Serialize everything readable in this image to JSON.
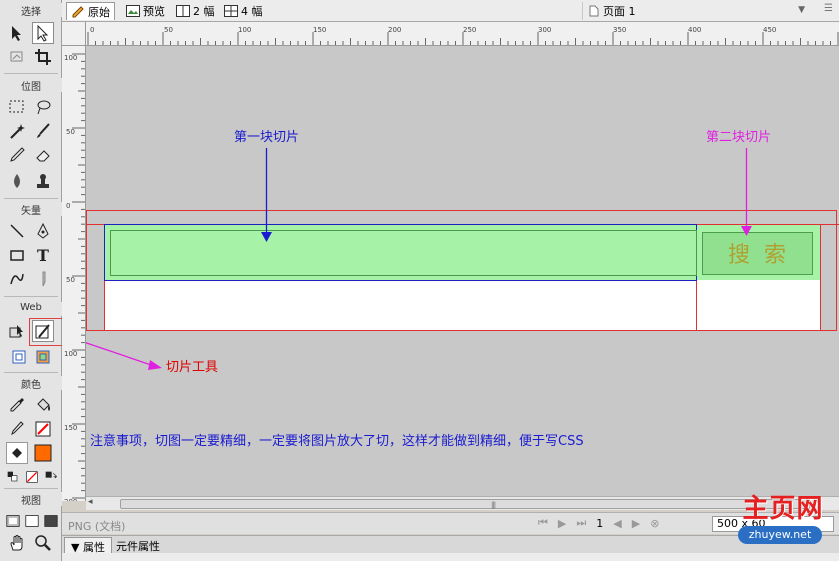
{
  "tools_panel": {
    "sections": [
      "选择",
      "位图",
      "矢量",
      "Web",
      "颜色",
      "视图"
    ],
    "icons": [
      "pointer-icon",
      "subselect-icon",
      "scale-icon",
      "crop-icon",
      "marquee-icon",
      "lasso-icon",
      "magic-wand-icon",
      "brush-icon",
      "pencil-icon",
      "eraser-icon",
      "blur-icon",
      "rubber-stamp-icon",
      "line-icon",
      "pen-icon",
      "rectangle-icon",
      "text-icon",
      "freeform-icon",
      "knife-icon",
      "hotspot-icon",
      "slice-icon",
      "hide-slices-icon",
      "show-slices-icon",
      "eyedropper-icon",
      "paint-bucket-icon",
      "stroke-color-icon",
      "fill-color-icon",
      "standard-screen-icon",
      "full-screen-menus-icon",
      "full-screen-icon",
      "hand-icon",
      "zoom-icon"
    ],
    "text_tool_glyph": "T",
    "fill_color": "#ff6a00",
    "stroke_color": "#ff0000"
  },
  "view_tabs": [
    {
      "label": "原始",
      "active": true
    },
    {
      "label": "预览",
      "active": false
    },
    {
      "label": "2 幅",
      "active": false
    },
    {
      "label": "4 幅",
      "active": false
    }
  ],
  "page_selector": {
    "label": "页面 1"
  },
  "ruler_h_labels": [
    "0",
    "50",
    "100",
    "150",
    "200",
    "250",
    "300",
    "350",
    "400",
    "450"
  ],
  "ruler_v_labels": [
    "100",
    "50",
    "0",
    "50",
    "100",
    "150",
    "200"
  ],
  "annotations": {
    "slice1": "第一块切片",
    "slice2": "第二块切片",
    "slice_tool": "切片工具",
    "note": "注意事项，切图一定要精细，一定要将图片放大了切，这样才能做到精细，便于写CSS"
  },
  "search_button_text": "搜  索",
  "status": {
    "doc_label": "PNG (文档)",
    "page_number": "1",
    "zoom": "500 x 60"
  },
  "property_tabs": [
    {
      "label": "▼ 属性",
      "active": true
    },
    {
      "label": "元件属性",
      "active": false
    }
  ],
  "watermark": {
    "title": "主页网",
    "url": "zhuyew.net"
  },
  "colors": {
    "annotation_blue": "#1a1ad0",
    "annotation_magenta": "#e020e0",
    "annotation_red": "#e00000",
    "slice_green": "#a6f2a6",
    "search_text": "#b0a030"
  }
}
